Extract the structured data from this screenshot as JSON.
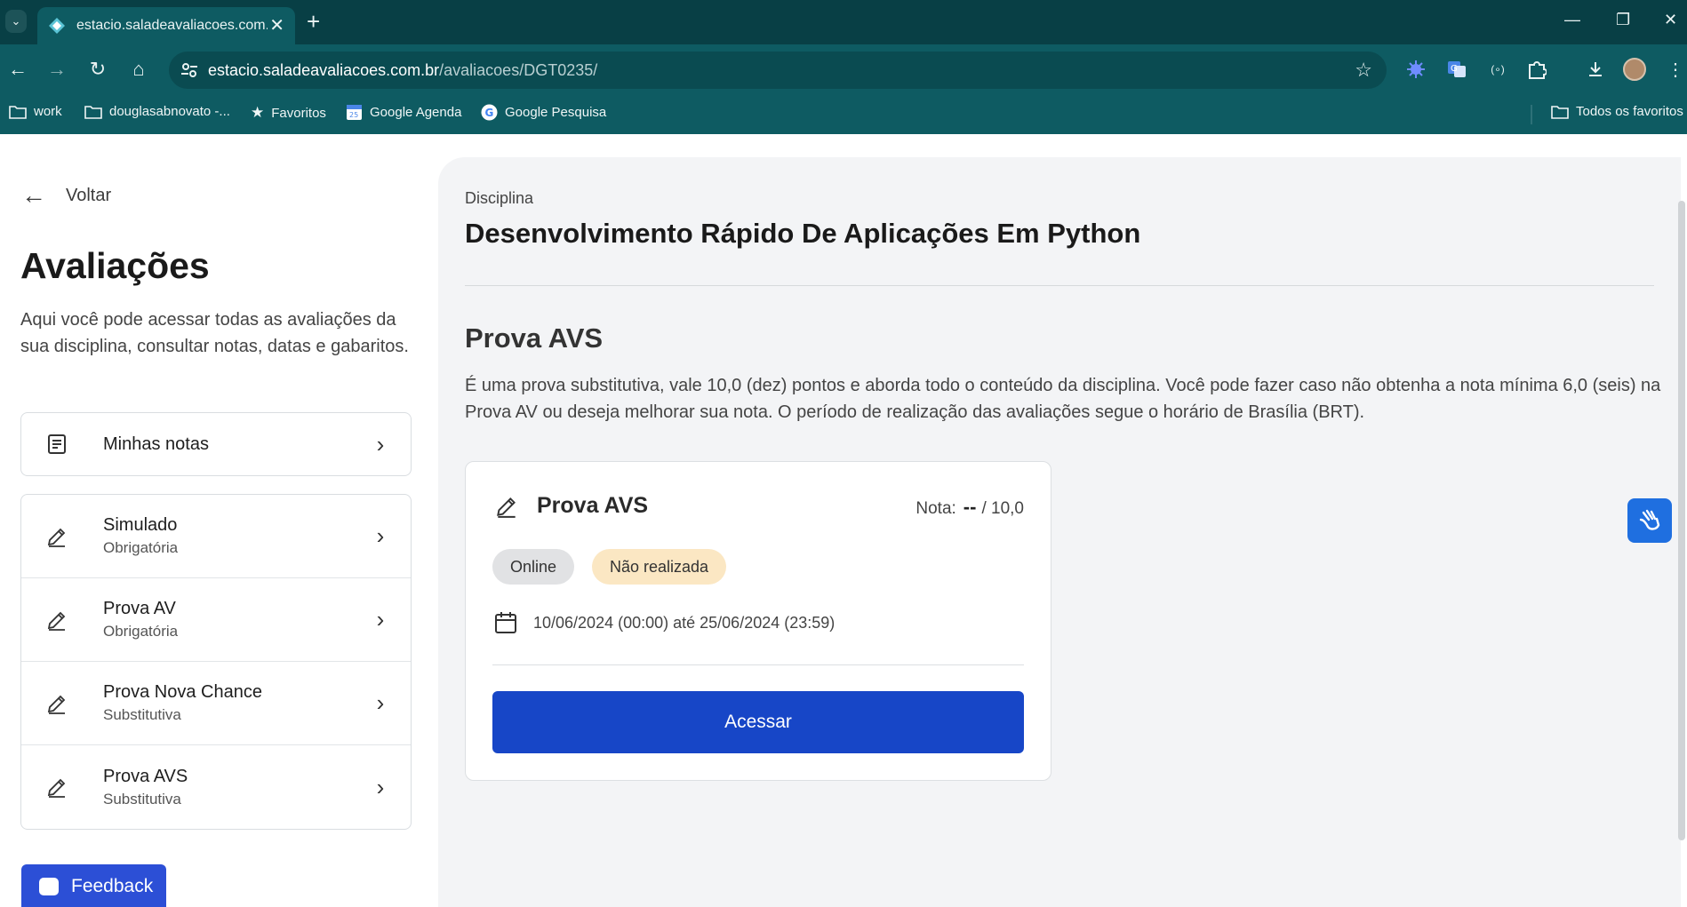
{
  "browser": {
    "tab_title": "estacio.saladeavaliacoes.com.br",
    "url_host": "estacio.saladeavaliacoes.com.br",
    "url_path": "/avaliacoes/DGT0235/",
    "bookmarks": [
      {
        "label": "work",
        "icon": "folder-icon"
      },
      {
        "label": "douglasabnovato -...",
        "icon": "folder-icon"
      },
      {
        "label": "Favoritos",
        "icon": "star-icon"
      },
      {
        "label": "Google Agenda",
        "icon": "calendar-icon"
      },
      {
        "label": "Google Pesquisa",
        "icon": "google-icon"
      }
    ],
    "all_bookmarks_label": "Todos os favoritos"
  },
  "sidebar": {
    "back_label": "Voltar",
    "title": "Avaliações",
    "description": "Aqui você pode acessar todas as avaliações da sua disciplina, consultar notas, datas e gabaritos.",
    "grades_label": "Minhas notas",
    "items": [
      {
        "title": "Simulado",
        "subtitle": "Obrigatória"
      },
      {
        "title": "Prova AV",
        "subtitle": "Obrigatória"
      },
      {
        "title": "Prova Nova Chance",
        "subtitle": "Substitutiva"
      },
      {
        "title": "Prova AVS",
        "subtitle": "Substitutiva"
      }
    ],
    "feedback_label": "Feedback"
  },
  "main": {
    "discipline_label": "Disciplina",
    "discipline_name": "Desenvolvimento Rápido De Aplicações Em Python",
    "exam_title": "Prova AVS",
    "exam_description": "É uma prova substitutiva, vale 10,0 (dez) pontos e aborda todo o conteúdo da disciplina. Você pode fazer caso não obtenha a nota mínima 6,0 (seis) na Prova AV ou deseja melhorar sua nota. O período de realização das avaliações segue o horário de Brasília (BRT).",
    "card": {
      "title": "Prova AVS",
      "grade_label": "Nota:",
      "grade_value": "--",
      "grade_max": "/ 10,0",
      "mode_badge": "Online",
      "status_badge": "Não realizada",
      "period": "10/06/2024 (00:00) até 25/06/2024 (23:59)",
      "access_label": "Acessar"
    }
  },
  "colors": {
    "chrome": "#0e5b62",
    "primary_button": "#1746c7",
    "status_badge_bg": "#fbe7c3",
    "feedback_bg": "#2c4fd6"
  }
}
